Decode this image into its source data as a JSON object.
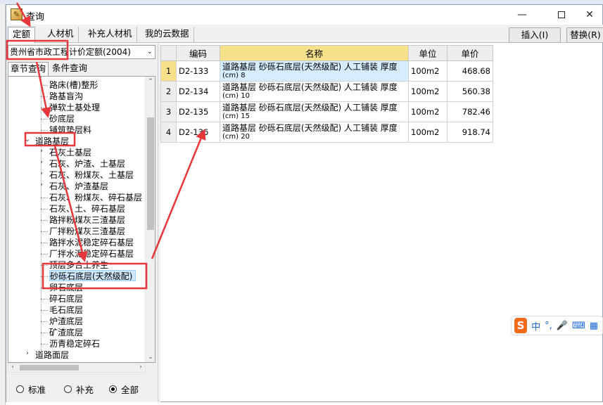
{
  "window": {
    "title": "查询",
    "min_glyph": "—",
    "close_glyph": "✕"
  },
  "top_tabs": [
    "定额",
    "人材机",
    "补充人材机",
    "我的云数据"
  ],
  "toolbar": {
    "insert_label": "插入(I)",
    "replace_label": "替换(R)"
  },
  "quota_select": {
    "value": "贵州省市政工程计价定额(2004)"
  },
  "sub_tabs": [
    "章节查询",
    "条件查询"
  ],
  "tree": [
    {
      "label": "路床(槽)整形",
      "level": 2,
      "twisty": ""
    },
    {
      "label": "路基盲沟",
      "level": 2,
      "twisty": ""
    },
    {
      "label": "弹软土基处理",
      "level": 2,
      "twisty": ""
    },
    {
      "label": "砂底层",
      "level": 2,
      "twisty": ""
    },
    {
      "label": "铺筑垫层料",
      "level": 2,
      "twisty": ""
    },
    {
      "label": "道路基层",
      "level": 1,
      "twisty": "⌄"
    },
    {
      "label": "石灰土基层",
      "level": 2,
      "twisty": "›"
    },
    {
      "label": "石灰、炉渣、土基层",
      "level": 2,
      "twisty": "›"
    },
    {
      "label": "石灰、粉煤灰、土基层",
      "level": 2,
      "twisty": "›"
    },
    {
      "label": "石灰、炉渣基层",
      "level": 2,
      "twisty": "›"
    },
    {
      "label": "石灰、粉煤灰、碎石基层",
      "level": 2,
      "twisty": ""
    },
    {
      "label": "石灰、土、碎石基层",
      "level": 2,
      "twisty": ""
    },
    {
      "label": "路拌粉煤灰三渣基层",
      "level": 2,
      "twisty": ""
    },
    {
      "label": "厂拌粉煤灰三渣基层",
      "level": 2,
      "twisty": ""
    },
    {
      "label": "路拌水泥稳定碎石基层",
      "level": 2,
      "twisty": ""
    },
    {
      "label": "厂拌水泥稳定碎石基层",
      "level": 2,
      "twisty": ""
    },
    {
      "label": "顶层多合土养生",
      "level": 2,
      "twisty": ""
    },
    {
      "label": "砂砾石底层(天然级配)",
      "level": 2,
      "twisty": "",
      "selected": true
    },
    {
      "label": "卵石底层",
      "level": 2,
      "twisty": ""
    },
    {
      "label": "碎石底层",
      "level": 2,
      "twisty": ""
    },
    {
      "label": "毛石底层",
      "level": 2,
      "twisty": ""
    },
    {
      "label": "炉渣底层",
      "level": 2,
      "twisty": ""
    },
    {
      "label": "矿渣底层",
      "level": 2,
      "twisty": ""
    },
    {
      "label": "沥青稳定碎石",
      "level": 2,
      "twisty": ""
    },
    {
      "label": "道路面层",
      "level": 1,
      "twisty": "›"
    }
  ],
  "filter_radios": [
    {
      "label": "标准",
      "checked": false
    },
    {
      "label": "补充",
      "checked": false
    },
    {
      "label": "全部",
      "checked": true
    }
  ],
  "grid": {
    "headers": {
      "code": "编码",
      "name": "名称",
      "unit": "单位",
      "price": "单价"
    },
    "rows": [
      {
        "no": "1",
        "code": "D2-133",
        "name1": "道路基层 砂砾石底层(天然级配) 人工铺装 厚度",
        "name2": "(cm) 8",
        "unit": "100m2",
        "price": "468.68"
      },
      {
        "no": "2",
        "code": "D2-134",
        "name1": "道路基层 砂砾石底层(天然级配) 人工铺装 厚度",
        "name2": "(cm) 10",
        "unit": "100m2",
        "price": "560.38"
      },
      {
        "no": "3",
        "code": "D2-135",
        "name1": "道路基层 砂砾石底层(天然级配) 人工铺装 厚度",
        "name2": "(cm) 15",
        "unit": "100m2",
        "price": "782.46"
      },
      {
        "no": "4",
        "code": "D2-136",
        "name1": "道路基层 砂砾石底层(天然级配) 人工铺装 厚度",
        "name2": "(cm) 20",
        "unit": "100m2",
        "price": "918.74"
      }
    ]
  },
  "ime": {
    "logo": "S",
    "mode": "中",
    "punct": "°,",
    "mic": "🎤",
    "kbd": "⌨",
    "grid": "▦"
  },
  "colors": {
    "annotation_red": "#e8373a",
    "header_yellow": "#f7e08a",
    "selection_blue": "#cde8ff"
  }
}
